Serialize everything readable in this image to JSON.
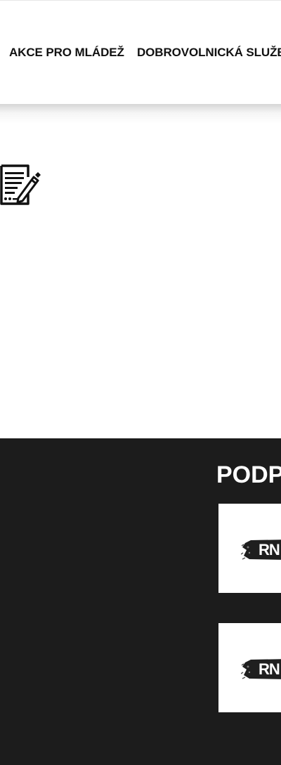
{
  "nav": {
    "items": [
      {
        "label": "AKCE PRO MLÁDEŽ"
      },
      {
        "label": "DOBROVOLNICKÁ SLUŽBA"
      }
    ]
  },
  "content": {
    "icon": "document-edit-icon"
  },
  "footer": {
    "title": "PODPORUJÍ NÁS",
    "partners": [
      {
        "logo_text": "RN",
        "icon": "partner-logo-icon"
      },
      {
        "logo_text": "RN",
        "icon": "partner-logo-icon"
      }
    ]
  },
  "colors": {
    "footer_bg": "#1c1c1c",
    "nav_text": "#111111",
    "card_bg": "#ffffff"
  }
}
